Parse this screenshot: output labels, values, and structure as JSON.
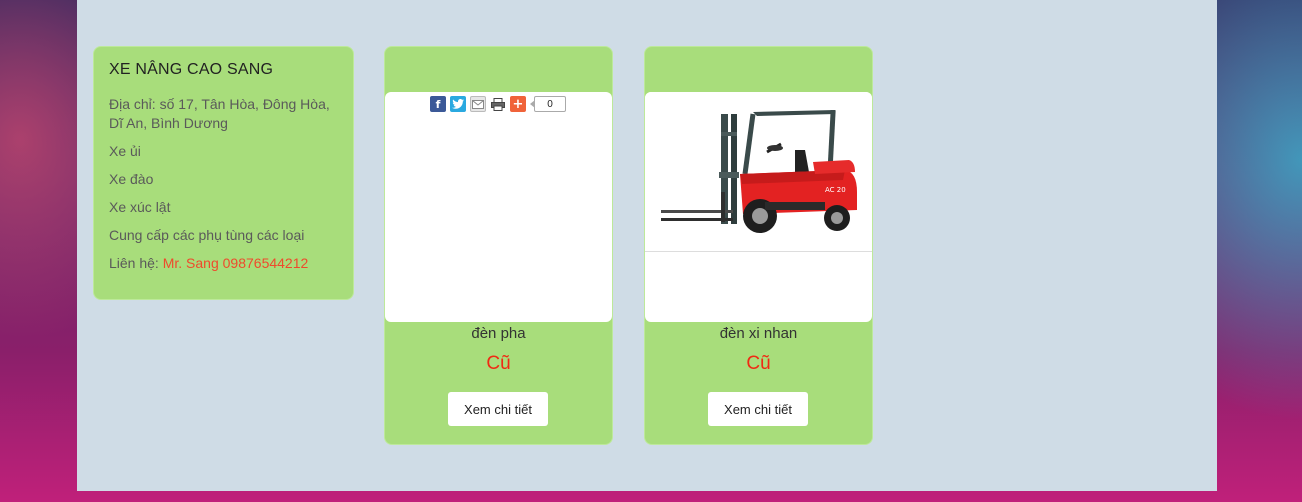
{
  "sidebar": {
    "title": "XE NÂNG CAO SANG",
    "address": "Địa chỉ: số 17, Tân Hòa, Đông Hòa, Dĩ An, Bình Dương",
    "items": [
      "Xe ủi",
      "Xe đào",
      "Xe xúc lật",
      "Cung cấp các phụ tùng các loại"
    ],
    "contact_label": "Liên hệ: ",
    "contact_value": "Mr. Sang 09876544212"
  },
  "share": {
    "count": "0"
  },
  "products": [
    {
      "name": "đèn pha",
      "status": "Cũ",
      "button": "Xem chi tiết"
    },
    {
      "name": "đèn xi nhan",
      "status": "Cũ",
      "button": "Xem chi tiết"
    }
  ],
  "colors": {
    "card_green": "#a8dd7b",
    "status_red": "#f02a14",
    "contact_red": "#ef4a2c",
    "content_bg": "#cfdce6"
  }
}
